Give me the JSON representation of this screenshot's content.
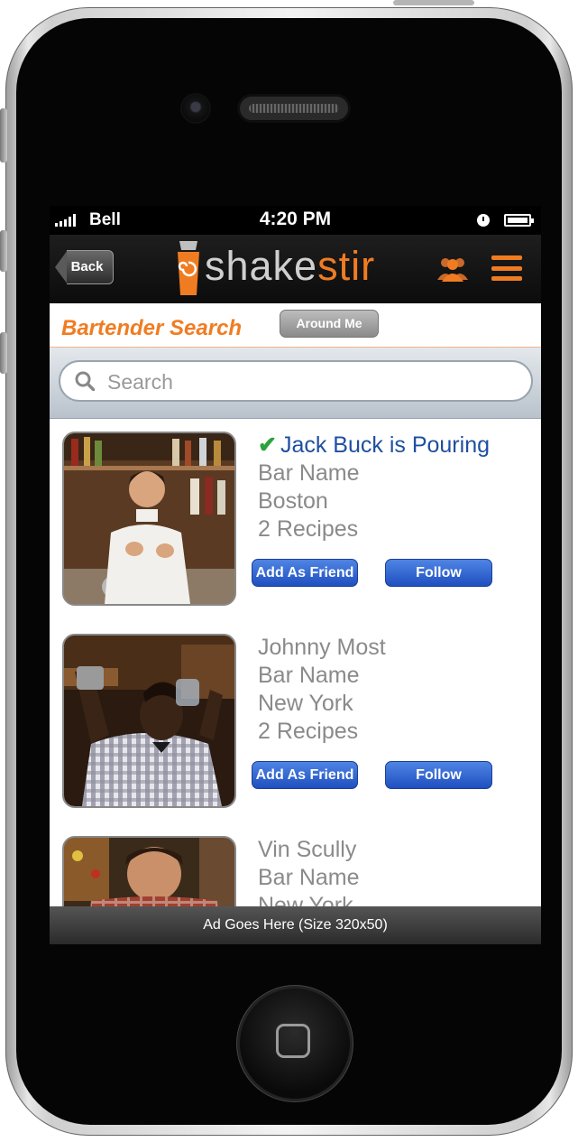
{
  "status_bar": {
    "carrier": "Bell",
    "time": "4:20 PM"
  },
  "nav": {
    "back_label": "Back",
    "logo_part1": "shake",
    "logo_part2": "stir"
  },
  "header": {
    "title": "Bartender Search",
    "around_me_label": "Around Me"
  },
  "search": {
    "placeholder": "Search",
    "value": ""
  },
  "bartenders": [
    {
      "name": "Jack Buck is Pouring",
      "pouring": true,
      "bar": "Bar Name",
      "city": "Boston",
      "recipes": "2 Recipes",
      "friend_label": "Add As Friend",
      "follow_label": "Follow"
    },
    {
      "name": "Johnny Most",
      "pouring": false,
      "bar": "Bar Name",
      "city": "New York",
      "recipes": "2 Recipes",
      "friend_label": "Add As Friend",
      "follow_label": "Follow"
    },
    {
      "name": "Vin Scully",
      "pouring": false,
      "bar": "Bar Name",
      "city": "New York",
      "recipes": "",
      "friend_label": "",
      "follow_label": ""
    }
  ],
  "ad": {
    "text": "Ad Goes Here (Size 320x50)"
  },
  "colors": {
    "accent": "#f07c22",
    "link_blue": "#1f4fa0",
    "button_blue": "#2f63d0",
    "check_green": "#2aa33a"
  }
}
